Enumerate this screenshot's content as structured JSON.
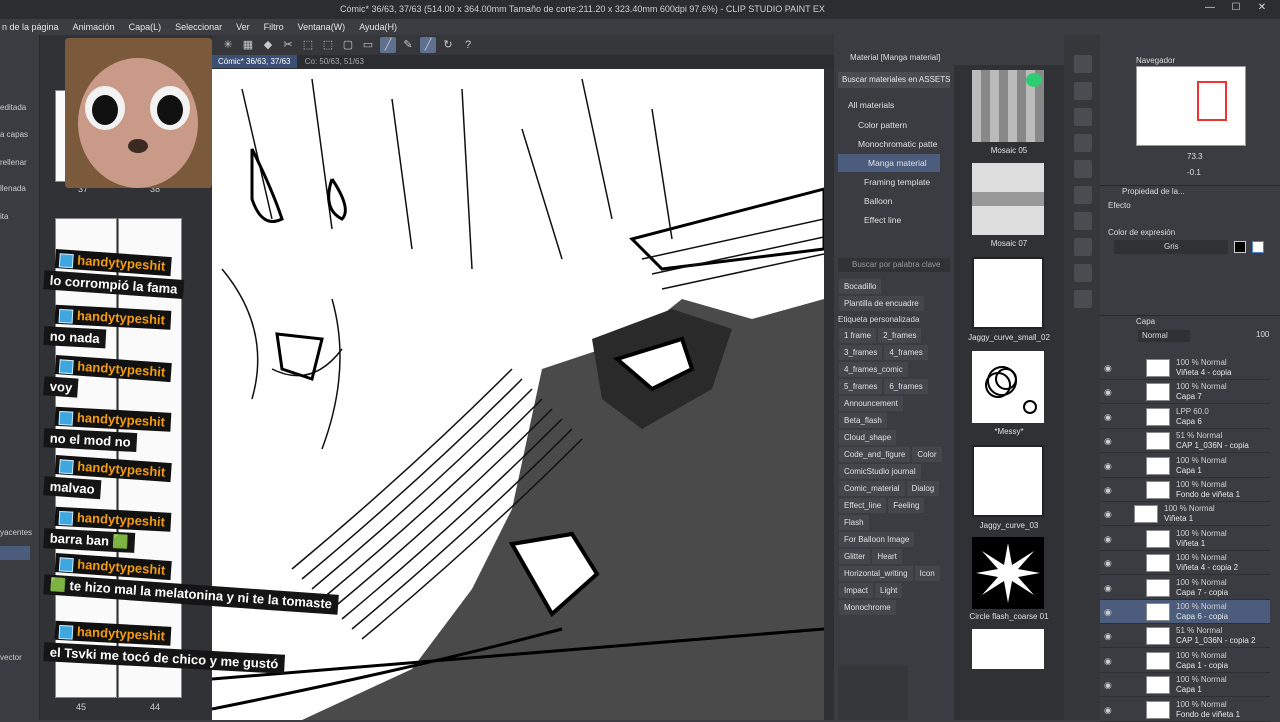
{
  "window": {
    "title": "Cómic* 36/63, 37/63 (514.00 x 364.00mm Tamaño de corte:211.20 x 323.40mm 600dpi 97.6%) - CLIP STUDIO PAINT EX"
  },
  "menu": [
    "n de la página",
    "Animación",
    "Capa(L)",
    "Seleccionar",
    "Ver",
    "Filtro",
    "Ventana(W)",
    "Ayuda(H)"
  ],
  "left_strip": [
    "editada",
    "a capas",
    "rellenar",
    "llenada",
    "ita",
    "yacentes",
    "vector"
  ],
  "page_panel": {
    "page_numbers": [
      "37",
      "38",
      "45",
      "44"
    ]
  },
  "tabs": [
    "Cómic* 36/63, 37/63",
    "Co: 50/63, 51/63"
  ],
  "material_panel": {
    "header": "Material [Manga material]",
    "search_assets": "Buscar materiales en ASSETS",
    "tree": [
      "All materials",
      "Color pattern",
      "Monochromatic patte",
      "Manga material",
      "Framing template",
      "Balloon",
      "Effect line"
    ],
    "search_placeholder": "Buscar por palabra clave",
    "tags_top": [
      "Bocadillo",
      "Plantilla de encuadre"
    ],
    "custom_tag_label": "Etiqueta personalizada",
    "tags": [
      "1 frame",
      "2_frames",
      "3_frames",
      "4_frames",
      "4_frames_comic",
      "5_frames",
      "6_frames",
      "Announcement",
      "Beta_flash",
      "Cloud_shape",
      "Code_and_figure",
      "Color",
      "ComicStudio journal",
      "Comic_material",
      "Dialog",
      "Effect_line",
      "Feeling",
      "Flash",
      "For Balloon Image",
      "Glitter",
      "Heart",
      "Horizontal_writing",
      "Icon",
      "Impact",
      "Light",
      "Monochrome"
    ],
    "thumbs": [
      "Mosaic 05",
      "Mosaic 07",
      "Jaggy_curve_small_02",
      "*Messy*",
      "Jaggy_curve_03",
      "Circle flash_coarse 01"
    ]
  },
  "navigator": {
    "title": "Navegador",
    "zoom": "73.3",
    "angle": "-0.1"
  },
  "properties": {
    "title": "Propiedad de la...",
    "effect_label": "Efecto",
    "color_label": "Color de expresión",
    "color_value": "Gris"
  },
  "layers": {
    "title": "Capa",
    "blend": "Normal",
    "opacity": "100",
    "items": [
      {
        "mode": "100 % Normal",
        "name": "Viñeta 4 - copia"
      },
      {
        "mode": "100 % Normal",
        "name": "Capa 7"
      },
      {
        "mode": "LPP 60.0",
        "name": "Capa 6"
      },
      {
        "mode": "51 % Normal",
        "name": "CAP 1_036N - copia"
      },
      {
        "mode": "100 % Normal",
        "name": "Capa 1"
      },
      {
        "mode": "100 % Normal",
        "name": "Fondo de viñeta 1"
      },
      {
        "mode": "100 % Normal",
        "name": "Viñeta 1"
      },
      {
        "mode": "100 % Normal",
        "name": "Viñeta 1"
      },
      {
        "mode": "100 % Normal",
        "name": "Viñeta 4 - copia 2"
      },
      {
        "mode": "100 % Normal",
        "name": "Capa 7 - copia"
      },
      {
        "mode": "100 % Normal",
        "name": "Capa 6 - copia"
      },
      {
        "mode": "51 % Normal",
        "name": "CAP 1_036N - copia 2"
      },
      {
        "mode": "100 % Normal",
        "name": "Capa 1 - copia"
      },
      {
        "mode": "100 % Normal",
        "name": "Capa 1"
      },
      {
        "mode": "100 % Normal",
        "name": "Fondo de viñeta 1"
      }
    ]
  },
  "chat": [
    {
      "user": "handytypeshit",
      "msg": "lo corrompió la fama"
    },
    {
      "user": "handytypeshit",
      "msg": "no nada"
    },
    {
      "user": "handytypeshit",
      "msg": "voy"
    },
    {
      "user": "handytypeshit",
      "msg": "no el mod no"
    },
    {
      "user": "handytypeshit",
      "msg": "malvao"
    },
    {
      "user": "handytypeshit",
      "msg": "barra ban 🟩"
    },
    {
      "user": "handytypeshit",
      "msg": "🟩 te hizo mal la melatonina y ni te la tomaste"
    },
    {
      "user": "handytypeshit",
      "msg": "el Tsvki me tocó de chico y me gustó"
    }
  ],
  "colors": {
    "accent": "#4b5c7d",
    "chat_user": "#f39c12",
    "chat_icon": "#3fa7e0"
  }
}
